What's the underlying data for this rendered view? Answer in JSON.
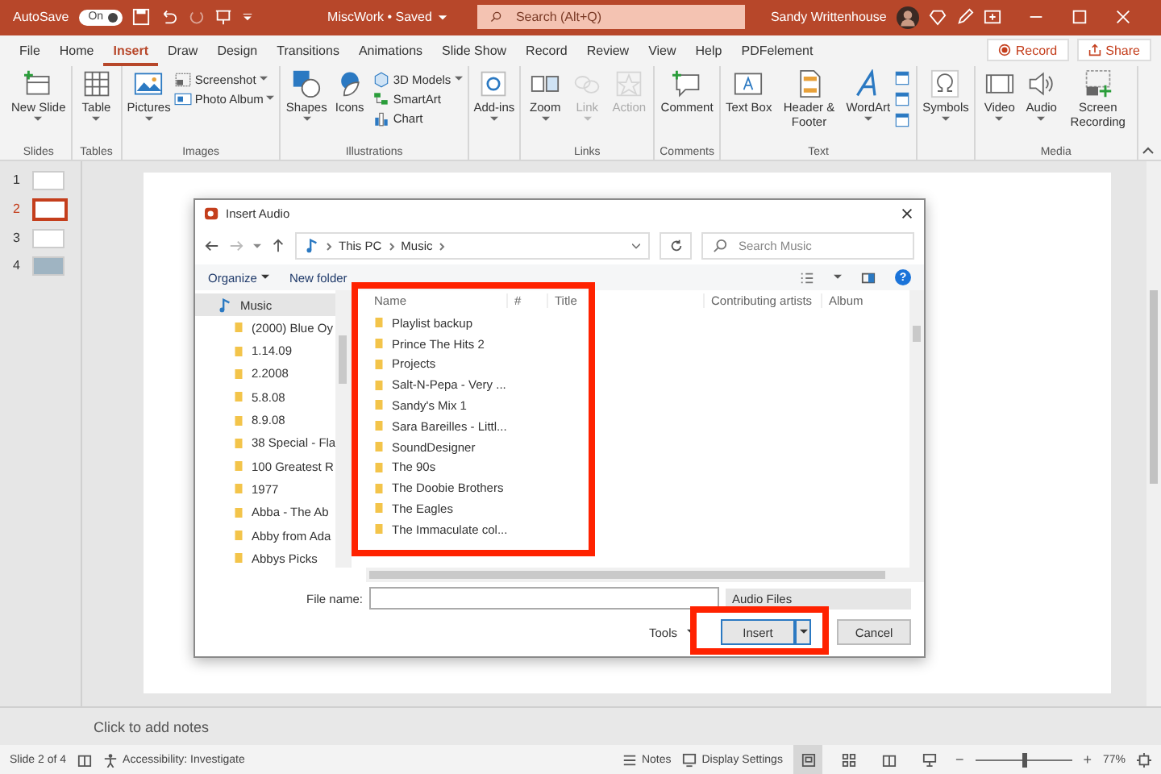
{
  "title_bar": {
    "autosave_label": "AutoSave",
    "autosave_toggle": {
      "label": "On",
      "on": true
    },
    "document_title": "MiscWork • Saved",
    "search": {
      "placeholder": "Search (Alt+Q)"
    },
    "user_name": "Sandy Writtenhouse"
  },
  "tabs": [
    {
      "label": "File",
      "selected": false
    },
    {
      "label": "Home",
      "selected": false
    },
    {
      "label": "Insert",
      "selected": true
    },
    {
      "label": "Draw",
      "selected": false
    },
    {
      "label": "Design",
      "selected": false
    },
    {
      "label": "Transitions",
      "selected": false
    },
    {
      "label": "Animations",
      "selected": false
    },
    {
      "label": "Slide Show",
      "selected": false
    },
    {
      "label": "Record",
      "selected": false
    },
    {
      "label": "Review",
      "selected": false
    },
    {
      "label": "View",
      "selected": false
    },
    {
      "label": "Help",
      "selected": false
    },
    {
      "label": "PDFelement",
      "selected": false
    }
  ],
  "tab_buttons": [
    {
      "label": "Record",
      "kind": "record"
    },
    {
      "label": "Share",
      "kind": "share"
    }
  ],
  "ribbon": [
    {
      "label": "Slides",
      "items": [
        {
          "label": "New Slide",
          "kind": "large",
          "dropdown": true,
          "disabled": false
        }
      ]
    },
    {
      "label": "Tables",
      "items": [
        {
          "label": "Table",
          "kind": "large",
          "dropdown": true,
          "disabled": false
        }
      ]
    },
    {
      "label": "Images",
      "items": [
        {
          "label": "Pictures",
          "kind": "large",
          "dropdown": true,
          "disabled": false
        },
        {
          "label": "Screenshot",
          "kind": "small",
          "dropdown": true,
          "disabled": false
        },
        {
          "label": "Photo Album",
          "kind": "small",
          "dropdown": true,
          "disabled": false
        }
      ]
    },
    {
      "label": "Illustrations",
      "items": [
        {
          "label": "Shapes",
          "kind": "large",
          "dropdown": true,
          "disabled": false
        },
        {
          "label": "Icons",
          "kind": "large",
          "dropdown": false,
          "disabled": false
        },
        {
          "label": "3D Models",
          "kind": "small",
          "dropdown": true,
          "disabled": false
        },
        {
          "label": "SmartArt",
          "kind": "small",
          "dropdown": false,
          "disabled": false
        },
        {
          "label": "Chart",
          "kind": "small",
          "dropdown": false,
          "disabled": false
        }
      ]
    },
    {
      "items": [
        {
          "label": "Add-ins",
          "kind": "large",
          "dropdown": true,
          "disabled": false
        }
      ]
    },
    {
      "label": "Links",
      "items": [
        {
          "label": "Zoom",
          "kind": "large",
          "dropdown": true,
          "disabled": false
        },
        {
          "label": "Link",
          "kind": "large",
          "dropdown": true,
          "disabled": true
        },
        {
          "label": "Action",
          "kind": "large",
          "dropdown": false,
          "disabled": true
        }
      ]
    },
    {
      "label": "Comments",
      "items": [
        {
          "label": "Comment",
          "kind": "large",
          "dropdown": false,
          "disabled": false
        }
      ]
    },
    {
      "label": "Text",
      "items": [
        {
          "label": "Text Box",
          "kind": "large",
          "dropdown": false,
          "disabled": false
        },
        {
          "label": "Header & Footer",
          "kind": "large",
          "dropdown": false,
          "disabled": false
        },
        {
          "label": "WordArt",
          "kind": "large",
          "dropdown": true,
          "disabled": false
        },
        {
          "kind": "icons",
          "dropdown": false,
          "disabled": false
        }
      ]
    },
    {
      "items": [
        {
          "label": "Symbols",
          "kind": "large",
          "dropdown": true,
          "disabled": false
        }
      ]
    },
    {
      "label": "Media",
      "items": [
        {
          "label": "Video",
          "kind": "large",
          "dropdown": true,
          "disabled": false
        },
        {
          "label": "Audio",
          "kind": "large",
          "dropdown": true,
          "disabled": false
        },
        {
          "label": "Screen Recording",
          "kind": "large",
          "dropdown": false,
          "disabled": false
        }
      ]
    }
  ],
  "slides": [
    {
      "number": "1",
      "selected": false
    },
    {
      "number": "2",
      "selected": true
    },
    {
      "number": "3",
      "selected": false
    },
    {
      "number": "4",
      "selected": false
    }
  ],
  "dialog": {
    "title": "Insert Audio",
    "path": [
      "This PC",
      "Music"
    ],
    "search": {
      "placeholder": "Search Music"
    },
    "toolbar": {
      "organize": "Organize",
      "new_folder": "New folder",
      "help_glyph": "?"
    },
    "tree": [
      {
        "label": "Music",
        "selected": true,
        "children": [
          {
            "label": "(2000) Blue Oy"
          },
          {
            "label": "1.14.09"
          },
          {
            "label": "2.2008"
          },
          {
            "label": "5.8.08"
          },
          {
            "label": "8.9.08"
          },
          {
            "label": "38 Special - Fla"
          },
          {
            "label": "100 Greatest R"
          },
          {
            "label": "1977"
          },
          {
            "label": "Abba - The Ab"
          },
          {
            "label": "Abby from Ada"
          },
          {
            "label": "Abbys Picks"
          }
        ]
      }
    ],
    "columns": [
      "Name",
      "#",
      "Title",
      "Contributing artists",
      "Album"
    ],
    "files": [
      "Playlist backup",
      "Prince The Hits 2",
      "Projects",
      "Salt-N-Pepa - Very ...",
      "Sandy's Mix 1",
      "Sara Bareilles - Littl...",
      "SoundDesigner",
      "The 90s",
      "The Doobie Brothers",
      "The Eagles",
      "The Immaculate col..."
    ],
    "file_name": {
      "label": "File name:"
    },
    "file_type": "Audio Files",
    "tools": "Tools",
    "insert": "Insert",
    "cancel": "Cancel"
  },
  "notes": {
    "placeholder": "Click to add notes"
  },
  "status_bar": {
    "slide_position": "Slide 2 of 4",
    "accessibility": "Accessibility: Investigate",
    "notes_button": "Notes",
    "display_settings": "Display Settings",
    "views": [
      {
        "selected": true
      },
      {
        "selected": false
      },
      {
        "selected": false
      },
      {
        "selected": false
      }
    ],
    "zoom": {
      "out_glyph": "−",
      "level": 0.5,
      "in_glyph": "+",
      "reading": "77%"
    }
  }
}
